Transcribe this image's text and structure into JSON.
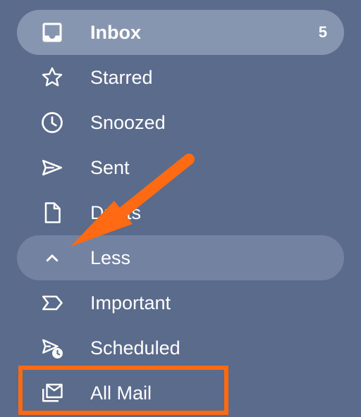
{
  "nav": {
    "items": [
      {
        "label": "Inbox",
        "count": "5",
        "icon": "inbox-icon"
      },
      {
        "label": "Starred",
        "icon": "star-icon"
      },
      {
        "label": "Snoozed",
        "icon": "clock-icon"
      },
      {
        "label": "Sent",
        "icon": "send-icon"
      },
      {
        "label": "Drafts",
        "icon": "draft-icon"
      },
      {
        "label": "Less",
        "icon": "chevron-up-icon"
      },
      {
        "label": "Important",
        "icon": "label-important-icon"
      },
      {
        "label": "Scheduled",
        "icon": "scheduled-send-icon"
      },
      {
        "label": "All Mail",
        "icon": "all-mail-icon"
      }
    ]
  },
  "colors": {
    "background": "#5a6b8c",
    "active_item": "#8796b0",
    "hover_item": "#7382a0",
    "annotation": "#ff6a13"
  }
}
